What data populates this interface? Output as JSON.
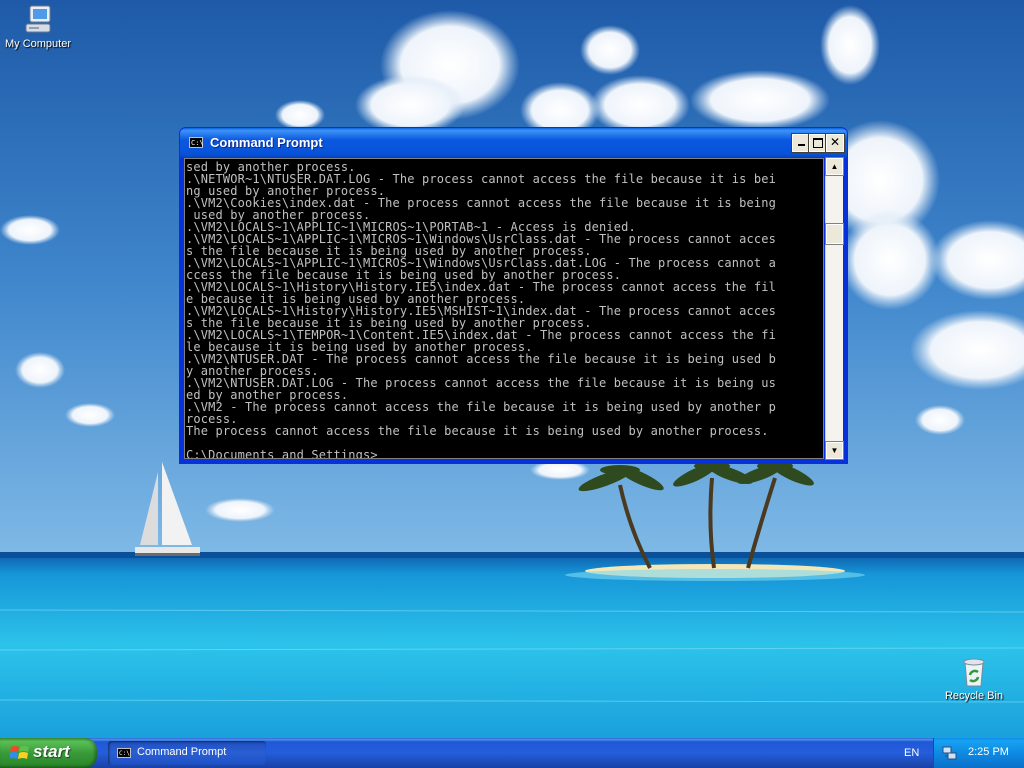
{
  "desktop": {
    "icons": [
      {
        "label": "My Computer",
        "icon": "my-computer-icon"
      },
      {
        "label": "Recycle Bin",
        "icon": "recycle-bin-icon"
      }
    ]
  },
  "window": {
    "title": "Command Prompt",
    "icon": "cmd-icon",
    "icon_text": "C:\\",
    "controls": {
      "minimize": "minimize-icon",
      "maximize": "maximize-icon",
      "close_label": "✕"
    },
    "console_lines": [
      "sed by another process.",
      ".\\NETWOR~1\\NTUSER.DAT.LOG - The process cannot access the file because it is bei",
      "ng used by another process.",
      ".\\VM2\\Cookies\\index.dat - The process cannot access the file because it is being",
      " used by another process.",
      ".\\VM2\\LOCALS~1\\APPLIC~1\\MICROS~1\\PORTAB~1 - Access is denied.",
      ".\\VM2\\LOCALS~1\\APPLIC~1\\MICROS~1\\Windows\\UsrClass.dat - The process cannot acces",
      "s the file because it is being used by another process.",
      ".\\VM2\\LOCALS~1\\APPLIC~1\\MICROS~1\\Windows\\UsrClass.dat.LOG - The process cannot a",
      "ccess the file because it is being used by another process.",
      ".\\VM2\\LOCALS~1\\History\\History.IE5\\index.dat - The process cannot access the fil",
      "e because it is being used by another process.",
      ".\\VM2\\LOCALS~1\\History\\History.IE5\\MSHIST~1\\index.dat - The process cannot acces",
      "s the file because it is being used by another process.",
      ".\\VM2\\LOCALS~1\\TEMPOR~1\\Content.IE5\\index.dat - The process cannot access the fi",
      "le because it is being used by another process.",
      ".\\VM2\\NTUSER.DAT - The process cannot access the file because it is being used b",
      "y another process.",
      ".\\VM2\\NTUSER.DAT.LOG - The process cannot access the file because it is being us",
      "ed by another process.",
      ".\\VM2 - The process cannot access the file because it is being used by another p",
      "rocess.",
      "The process cannot access the file because it is being used by another process.",
      ""
    ],
    "prompt": "C:\\Documents and Settings>",
    "scrollbar": {
      "up": "▲",
      "down": "▼",
      "position": 0.2
    }
  },
  "taskbar": {
    "start_label": "start",
    "start_icon": "windows-flag-icon",
    "tasks": [
      {
        "label": "Command Prompt",
        "icon": "cmd-icon",
        "icon_text": "C:\\"
      }
    ],
    "language": "EN",
    "tray_icon": "network-icon",
    "clock": "2:25 PM"
  },
  "colors": {
    "console_bg": "#000000",
    "console_fg": "#c0c0c0",
    "titlebar": "#0b58e0",
    "taskbar": "#245edb",
    "start": "#3a9a3a"
  }
}
